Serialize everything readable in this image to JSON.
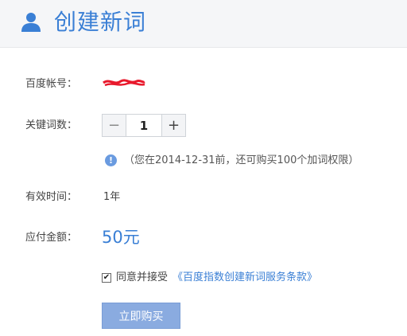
{
  "header": {
    "title": "创建新词",
    "icon": "user-icon"
  },
  "account": {
    "label": "百度帐号："
  },
  "keywords": {
    "label": "关键词数：",
    "minus": "−",
    "plus": "+",
    "value": "1"
  },
  "notice": {
    "icon": "info-icon",
    "glyph": "!",
    "text": "（您在2014-12-31前，还可购买100个加词权限）"
  },
  "validity": {
    "label": "有效时间：",
    "value": "1年"
  },
  "payment": {
    "label": "应付金额：",
    "amount": "50元"
  },
  "agreement": {
    "checkbox_mark": "✔",
    "label": "同意并接受",
    "link": "《百度指数创建新词服务条款》",
    "checked": true
  },
  "actions": {
    "buy_label": "立即购买"
  },
  "colors": {
    "accent": "#3a7fd5",
    "button_bg": "#8aabe0",
    "redaction": "#e8192c"
  }
}
